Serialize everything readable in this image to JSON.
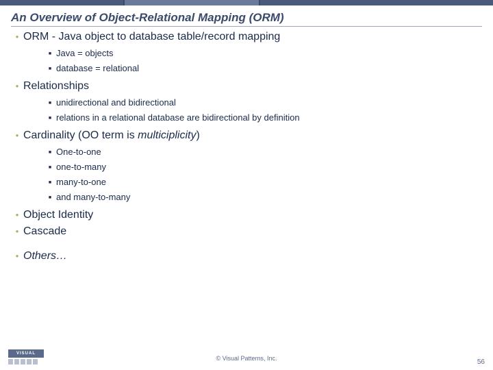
{
  "title": "An Overview of Object-Relational Mapping (ORM)",
  "bullets": {
    "b1": {
      "text": "ORM - Java object to database table/record mapping",
      "sub": {
        "s1": "Java = objects",
        "s2": "database = relational"
      }
    },
    "b2": {
      "text": "Relationships",
      "sub": {
        "s1": "unidirectional and bidirectional",
        "s2": "relations in a relational database are bidirectional by definition"
      }
    },
    "b3": {
      "prefix": "Cardinality (OO term is ",
      "italic": "multiciplicity",
      "suffix": ")",
      "sub": {
        "s1": "One-to-one",
        "s2": "one-to-many",
        "s3": "many-to-one",
        "s4": "and many-to-many"
      }
    },
    "b4": {
      "text": "Object Identity"
    },
    "b5": {
      "text": "Cascade"
    },
    "b6": {
      "italic": "Others…"
    }
  },
  "footer": {
    "logo_text": "VISUAL",
    "copyright": "© Visual Patterns, Inc.",
    "page": "56"
  }
}
